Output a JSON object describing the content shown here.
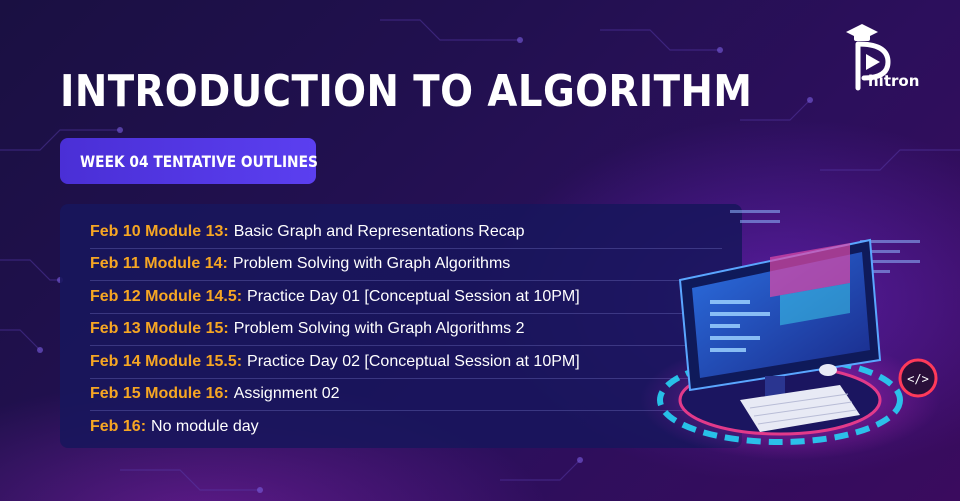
{
  "title": "INTRODUCTION TO ALGORITHM",
  "badge": "WEEK 04 TENTATIVE OUTLINES",
  "brand": {
    "name": "hitron",
    "letter": "P"
  },
  "outline": [
    {
      "key": "Feb 10 Module 13:",
      "value": "Basic Graph and Representations Recap"
    },
    {
      "key": "Feb 11 Module 14:",
      "value": "Problem Solving with Graph Algorithms"
    },
    {
      "key": "Feb 12 Module 14.5:",
      "value": "Practice Day 01 [Conceptual Session at 10PM]"
    },
    {
      "key": "Feb 13 Module 15:",
      "value": "Problem Solving with Graph Algorithms 2"
    },
    {
      "key": "Feb 14 Module 15.5:",
      "value": "Practice Day 02 [Conceptual Session at 10PM]"
    },
    {
      "key": "Feb 15 Module 16:",
      "value": "Assignment 02"
    },
    {
      "key": "Feb 16:",
      "value": " No module day"
    }
  ],
  "colors": {
    "accent_orange": "#f6a623",
    "badge_blue": "#5b3ff0",
    "panel": "#18165c"
  },
  "icons": [
    "graduation-cap-icon",
    "play-icon",
    "code-icon"
  ]
}
